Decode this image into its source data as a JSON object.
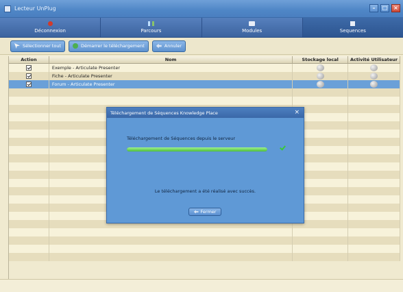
{
  "window": {
    "title": "Lecteur UnPlug",
    "minimize_icon": "minimize-icon",
    "maximize_icon": "maximize-icon",
    "close_icon": "close-icon"
  },
  "nav": {
    "tabs": [
      {
        "label": "Déconnexion",
        "icon": "power-icon"
      },
      {
        "label": "Parcours",
        "icon": "route-icon"
      },
      {
        "label": "Modules",
        "icon": "modules-icon"
      },
      {
        "label": "Sequences",
        "icon": "sequences-icon",
        "active": true
      }
    ]
  },
  "toolbar": {
    "select_all": "Sélectionner tout",
    "start_download": "Démarrer le téléchargement",
    "cancel": "Annuler"
  },
  "table": {
    "headers": {
      "action": "Action",
      "name": "Nom",
      "local_storage": "Stockage local",
      "user_activity": "Activité Utilisateur"
    },
    "rows": [
      {
        "checked": true,
        "name": "Exemple - Articulate Presenter",
        "selected": false
      },
      {
        "checked": true,
        "name": "Fiche - Articulate Presenter",
        "selected": false
      },
      {
        "checked": true,
        "name": "Forum - Articulate Presenter",
        "selected": true
      }
    ],
    "empty_row_count": 21
  },
  "dialog": {
    "title": "Téléchargement de Séquences Knowledge Place",
    "close_label": "×",
    "heading": "Téléchargement de Séquences depuis le serveur",
    "progress": 1.0,
    "message": "Le téléchargement a été réalisé avec succès.",
    "close_button": "Fermer"
  },
  "colors": {
    "accent": "#5f99d6",
    "selected_row": "#6aa0d8",
    "progress_fill": "#4fbf3b"
  }
}
